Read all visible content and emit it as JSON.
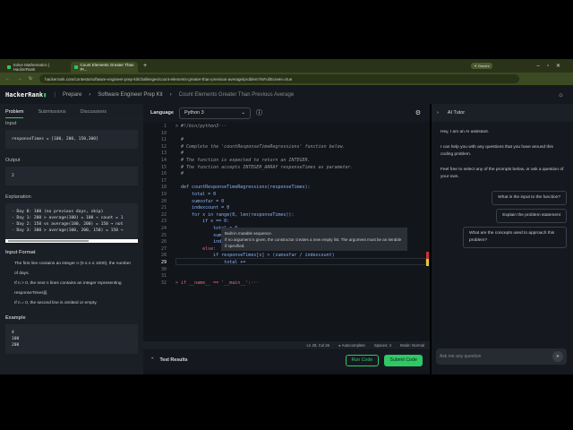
{
  "browser": {
    "tabs": [
      {
        "label": "Solve Mathematics | HackerRank"
      },
      {
        "label": "Count Elements Greater Than Pr..."
      }
    ],
    "url": "hackerrank.com/contests/software-engineer-prep-kit/challenges/count-elements-greater-than-previous-average/problem?isFullScreen=true",
    "gemini": "Gemini"
  },
  "header": {
    "logo": "HackerRank",
    "breadcrumb": [
      "Prepare",
      "Software Engineer Prep Kit",
      "Count Elements Greater Than Previous Average"
    ]
  },
  "left": {
    "tabs": [
      "Problem",
      "Submissions",
      "Discussions"
    ],
    "input_label": "Input",
    "input_value": "responseTimes = [100, 200, 150,300]",
    "output_label": "Output",
    "output_value": "2",
    "explanation_label": "Explanation",
    "explanation": "- Day 0: 100 (no previous days, skip)\n- Day 1: 200 > average(100) = 100 → count = 1\n- Day 2: 150 vs average(100, 200) = 150 → not\n- Day 3: 300 > average(100, 200, 150) = 150 →",
    "input_format_label": "Input Format",
    "input_format": [
      "The first line contains an integer n (0 ≤ n ≤ 1000), the number of days.",
      "If n > 0, the next n lines contains an integer representing responseTimes[i].",
      "If n = 0, the second line is omitted or empty."
    ],
    "example_label": "Example",
    "example": "4\n100\n200"
  },
  "editor": {
    "language_label": "Language",
    "language": "Python 3",
    "lines": [
      {
        "n": "1",
        "t": "> #!/bin/python3···",
        "c": "cm"
      },
      {
        "n": "10",
        "t": "",
        "c": "tx"
      },
      {
        "n": "11",
        "t": "  #",
        "c": "cm"
      },
      {
        "n": "12",
        "t": "  # Complete the 'countResponseTimeRegressions' function below.",
        "c": "cm"
      },
      {
        "n": "13",
        "t": "  #",
        "c": "cm"
      },
      {
        "n": "14",
        "t": "  # The function is expected to return an INTEGER.",
        "c": "cm"
      },
      {
        "n": "15",
        "t": "  # The function accepts INTEGER_ARRAY responseTimes as parameter.",
        "c": "cm"
      },
      {
        "n": "16",
        "t": "  #",
        "c": "cm"
      },
      {
        "n": "17",
        "t": "",
        "c": "tx"
      },
      {
        "n": "18",
        "t": "  def countResponseTimeRegressions(responseTimes):",
        "c": "fn"
      },
      {
        "n": "19",
        "t": "      total = 0",
        "c": "fn"
      },
      {
        "n": "20",
        "t": "      sumsofar = 0",
        "c": "fn"
      },
      {
        "n": "21",
        "t": "      indexcount = 0",
        "c": "fn"
      },
      {
        "n": "22",
        "t": "      for x in range(0, len(responseTimes)):",
        "c": "fn"
      },
      {
        "n": "23",
        "t": "          if x == 0:",
        "c": "fn"
      },
      {
        "n": "24",
        "t": "              total = 0",
        "c": "fn"
      },
      {
        "n": "25",
        "t": "              sumsofar",
        "c": "fn"
      },
      {
        "n": "26",
        "t": "              indexcount",
        "c": "fn"
      },
      {
        "n": "27",
        "t": "          else:",
        "c": "kw"
      },
      {
        "n": "28",
        "t": "              if responseTimes[x] > (sumsofar / indexcount)",
        "c": "fn"
      },
      {
        "n": "29",
        "t": "                  total +=",
        "c": "fn"
      },
      {
        "n": "30",
        "t": "",
        "c": "tx"
      },
      {
        "n": "31",
        "t": "",
        "c": "tx"
      },
      {
        "n": "32",
        "t": "> if __name__ == '__main__':···",
        "c": "kw"
      }
    ],
    "tooltip": [
      "Built-in mutable sequence.",
      "If no argument is given, the constructor creates a new empty list. The argument must be an iterable if specified."
    ],
    "status": {
      "position": "Ln 29, Col 26",
      "autocomplete": "Autocomplete",
      "spaces": "Spaces: 4",
      "mode": "Mode: Normal"
    },
    "test_results": "Test Results",
    "run": "Run Code",
    "submit": "Submit Code"
  },
  "ai": {
    "title": "AI Tutor",
    "messages": [
      "Hey, I am an AI assistant.",
      "I can help you with any questions that you have around this coding problem.",
      "Feel free to select any of the prompts below, or ask a question of your own."
    ],
    "prompts": [
      "What is the input to the function?",
      "Explain the problem statement",
      "What are the concepts used to approach this problem?"
    ],
    "placeholder": "Ask me any question"
  }
}
